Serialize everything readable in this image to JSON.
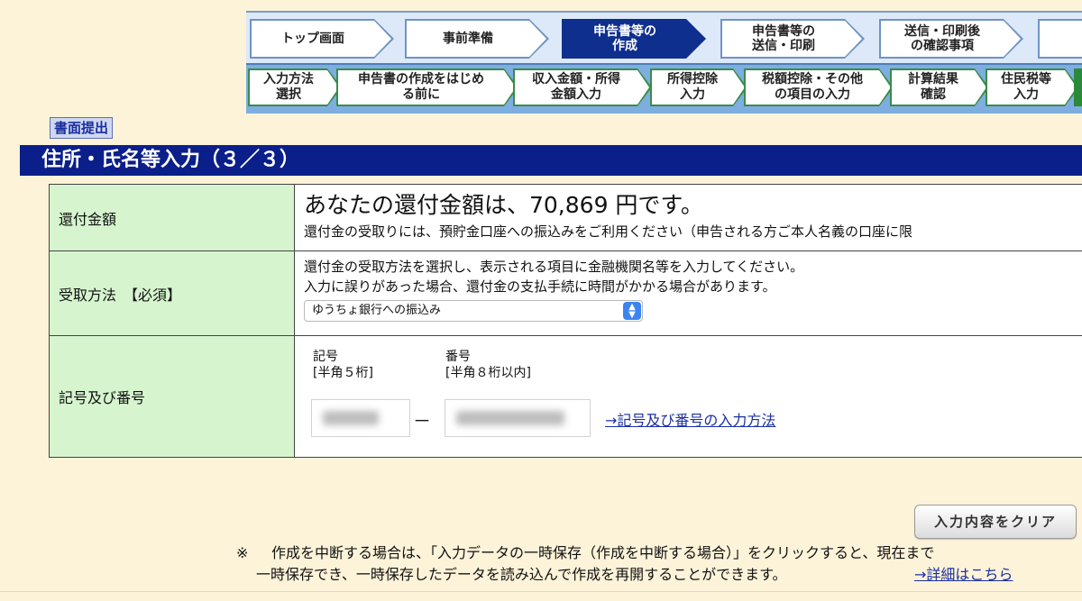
{
  "steps": [
    {
      "label": "トップ画面",
      "active": false
    },
    {
      "label": "事前準備",
      "active": false
    },
    {
      "label": "申告書等の\n作成",
      "active": true
    },
    {
      "label": "申告書等の\n送信・印刷",
      "active": false
    },
    {
      "label": "送信・印刷後\nの確認事項",
      "active": false
    }
  ],
  "substeps": [
    "入力方法\n選択",
    "申告書の作成をはじめ\nる前に",
    "収入金額・所得\n金額入力",
    "所得控除\n入力",
    "税額控除・その他\nの項目の入力",
    "計算結果\n確認",
    "住民税等\n入力"
  ],
  "paper_button": "書面提出",
  "page_title": "住所・氏名等入力（３／３）",
  "refund": {
    "label": "還付金額",
    "amount_text": "あなたの還付金額は、70,869 円です。",
    "note": "還付金の受取りには、預貯金口座への振込みをご利用ください（申告される方ご本人名義の口座に限"
  },
  "receipt": {
    "label": "受取方法　【必須】",
    "line1": "還付金の受取方法を選択し、表示される項目に金融機関名等を入力してください。",
    "line2": "入力に誤りがあった場合、還付金の支払手続に時間がかかる場合があります。",
    "selected": "ゆうちょ銀行への振込み"
  },
  "account": {
    "label": "記号及び番号",
    "symbol_head": "記号",
    "symbol_hint": "[半角５桁]",
    "number_head": "番号",
    "number_hint": "[半角８桁以内]",
    "dash": "－",
    "help_link": "→記号及び番号の入力方法"
  },
  "clear_button": "入力内容をクリア",
  "note": {
    "mark": "※",
    "line1": "作成を中断する場合は、「入力データの一時保存（作成を中断する場合）」をクリックすると、現在まで",
    "line2": "一時保存でき、一時保存したデータを読み込んで作成を再開することができます。",
    "detail_link": "→詳細はこちら"
  }
}
